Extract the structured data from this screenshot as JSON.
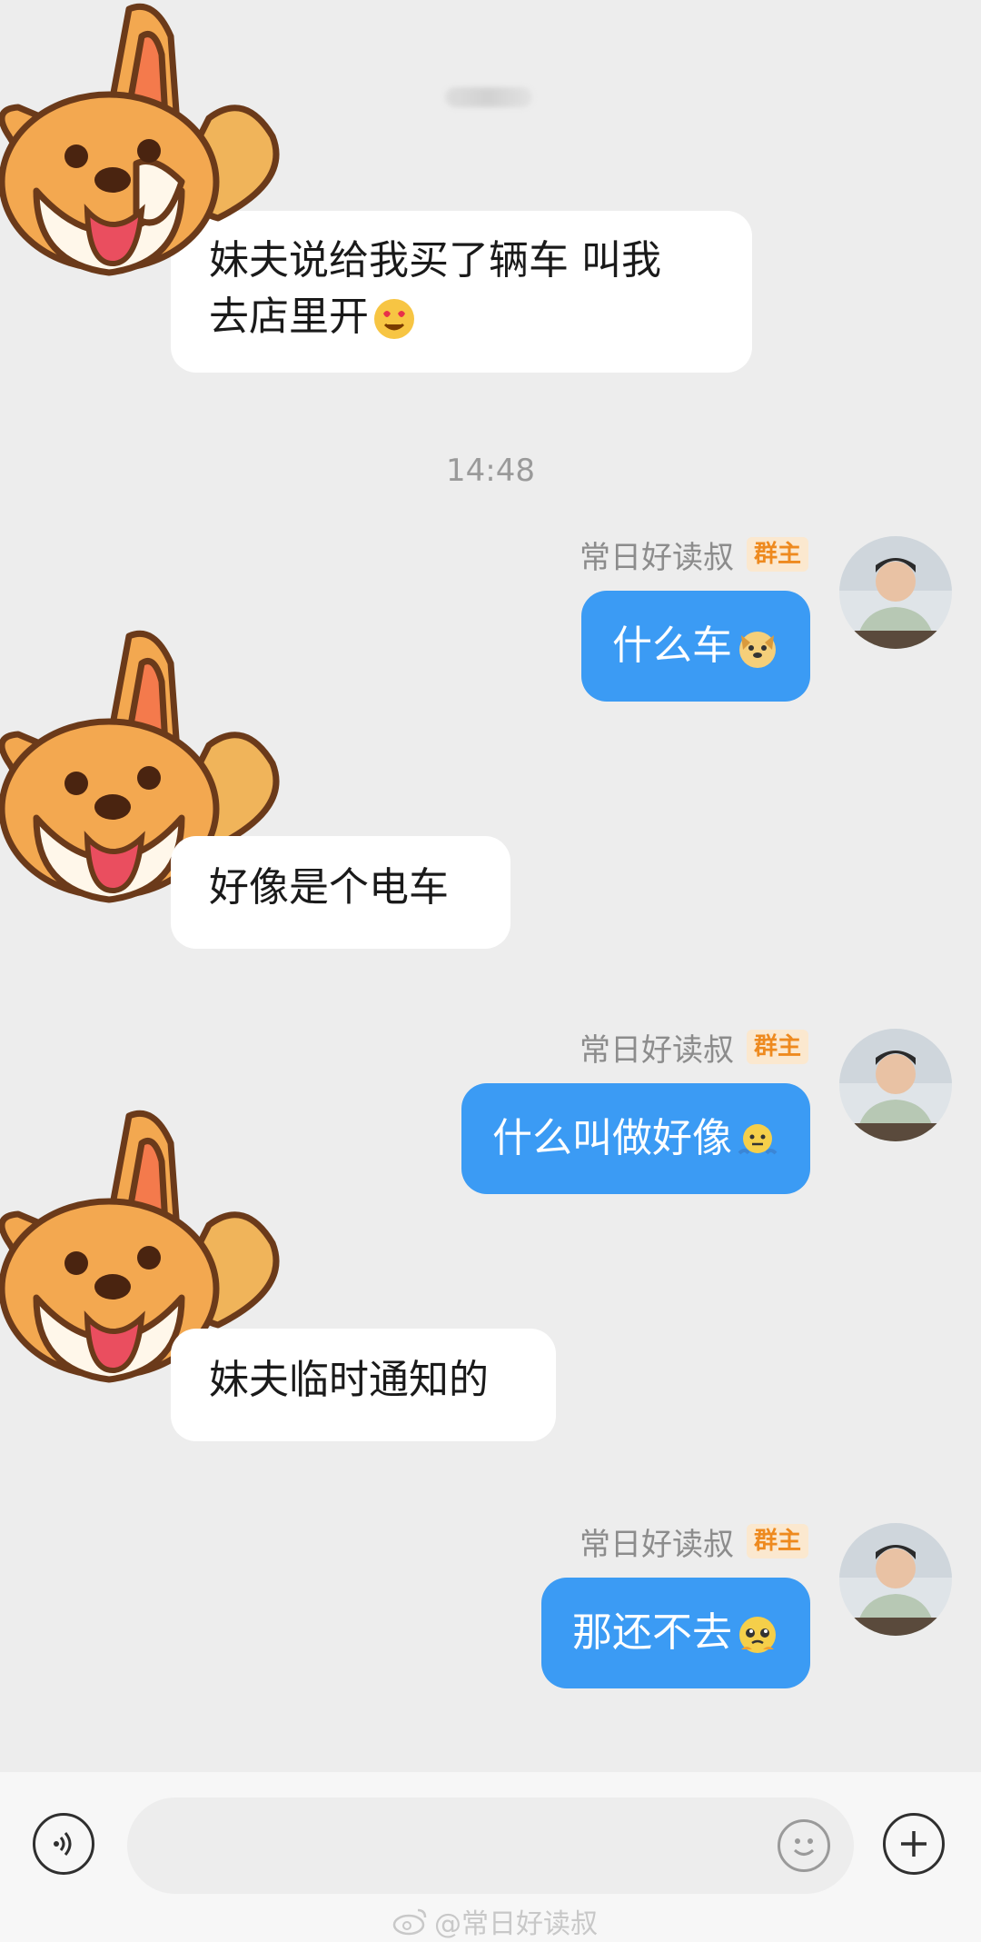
{
  "chat": {
    "timestamp": "14:48",
    "sender_name": "常日好读叔",
    "sender_badge": "群主",
    "messages": [
      {
        "side": "in",
        "text": "妹夫说给我买了辆车 叫我",
        "text2": "去店里开",
        "emoji": "heart-eyes-emoji"
      },
      {
        "side": "out",
        "text": "什么车",
        "emoji": "dog-face-emoji"
      },
      {
        "side": "in",
        "text": "好像是个电车"
      },
      {
        "side": "out",
        "text": "什么叫做好像",
        "emoji": "shrug-emoji"
      },
      {
        "side": "in",
        "text": "妹夫临时通知的"
      },
      {
        "side": "out",
        "text": "那还不去",
        "emoji": "pleading-emoji"
      }
    ]
  },
  "input_bar": {
    "voice_icon": "voice-icon",
    "emoji_icon": "smiley-icon",
    "plus_icon": "plus-icon"
  },
  "watermark": "@常日好读叔",
  "colors": {
    "background": "#ededed",
    "outgoing_bubble": "#3b9bf4",
    "incoming_bubble": "#ffffff",
    "badge_text": "#ee8a1f"
  }
}
